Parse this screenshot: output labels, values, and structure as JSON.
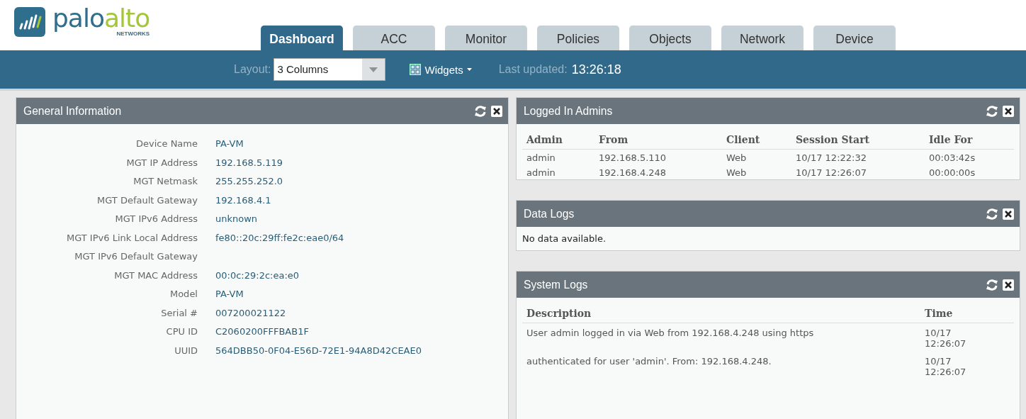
{
  "logo": {
    "word_1": "palo",
    "word_2": "alto",
    "subtitle": "NETWORKS"
  },
  "tabs": [
    {
      "label": "Dashboard",
      "selected": true
    },
    {
      "label": "ACC",
      "selected": false
    },
    {
      "label": "Monitor",
      "selected": false
    },
    {
      "label": "Policies",
      "selected": false
    },
    {
      "label": "Objects",
      "selected": false
    },
    {
      "label": "Network",
      "selected": false
    },
    {
      "label": "Device",
      "selected": false
    }
  ],
  "toolbar": {
    "layout_label": "Layout:",
    "layout_value": "3 Columns",
    "widgets_label": "Widgets",
    "updated_label": "Last updated:",
    "updated_value": "13:26:18"
  },
  "general_information": {
    "title": "General Information",
    "rows": [
      {
        "label": "Device Name",
        "value": "PA-VM"
      },
      {
        "label": "MGT IP Address",
        "value": "192.168.5.119"
      },
      {
        "label": "MGT Netmask",
        "value": "255.255.252.0"
      },
      {
        "label": "MGT Default Gateway",
        "value": "192.168.4.1"
      },
      {
        "label": "MGT IPv6 Address",
        "value": "unknown"
      },
      {
        "label": "MGT IPv6 Link Local Address",
        "value": "fe80::20c:29ff:fe2c:eae0/64"
      },
      {
        "label": "MGT IPv6 Default Gateway"
      },
      {
        "label": "MGT MAC Address",
        "value": "00:0c:29:2c:ea:e0"
      },
      {
        "label": "Model",
        "value": "PA-VM"
      },
      {
        "label": "Serial #",
        "value": "007200021122"
      },
      {
        "label": "CPU ID",
        "value": "C2060200FFFBAB1F"
      },
      {
        "label": "UUID",
        "value": "564DBB50-0F04-E56D-72E1-94A8D42CEAE0"
      }
    ]
  },
  "logged_in_admins": {
    "title": "Logged In Admins",
    "columns": [
      "Admin",
      "From",
      "Client",
      "Session Start",
      "Idle For"
    ],
    "rows": [
      [
        "admin",
        "192.168.5.110",
        "Web",
        "10/17 12:22:32",
        "00:03:42s"
      ],
      [
        "admin",
        "192.168.4.248",
        "Web",
        "10/17 12:26:07",
        "00:00:00s"
      ]
    ]
  },
  "data_logs": {
    "title": "Data Logs",
    "message": "No data available."
  },
  "system_logs": {
    "title": "System Logs",
    "columns": [
      "Description",
      "Time"
    ],
    "rows": [
      [
        "User admin logged in via Web from 192.168.4.248 using https",
        "10/17 12:26:07"
      ],
      [
        "authenticated for user 'admin'. From: 192.168.4.248.",
        "10/17 12:26:07"
      ]
    ]
  }
}
